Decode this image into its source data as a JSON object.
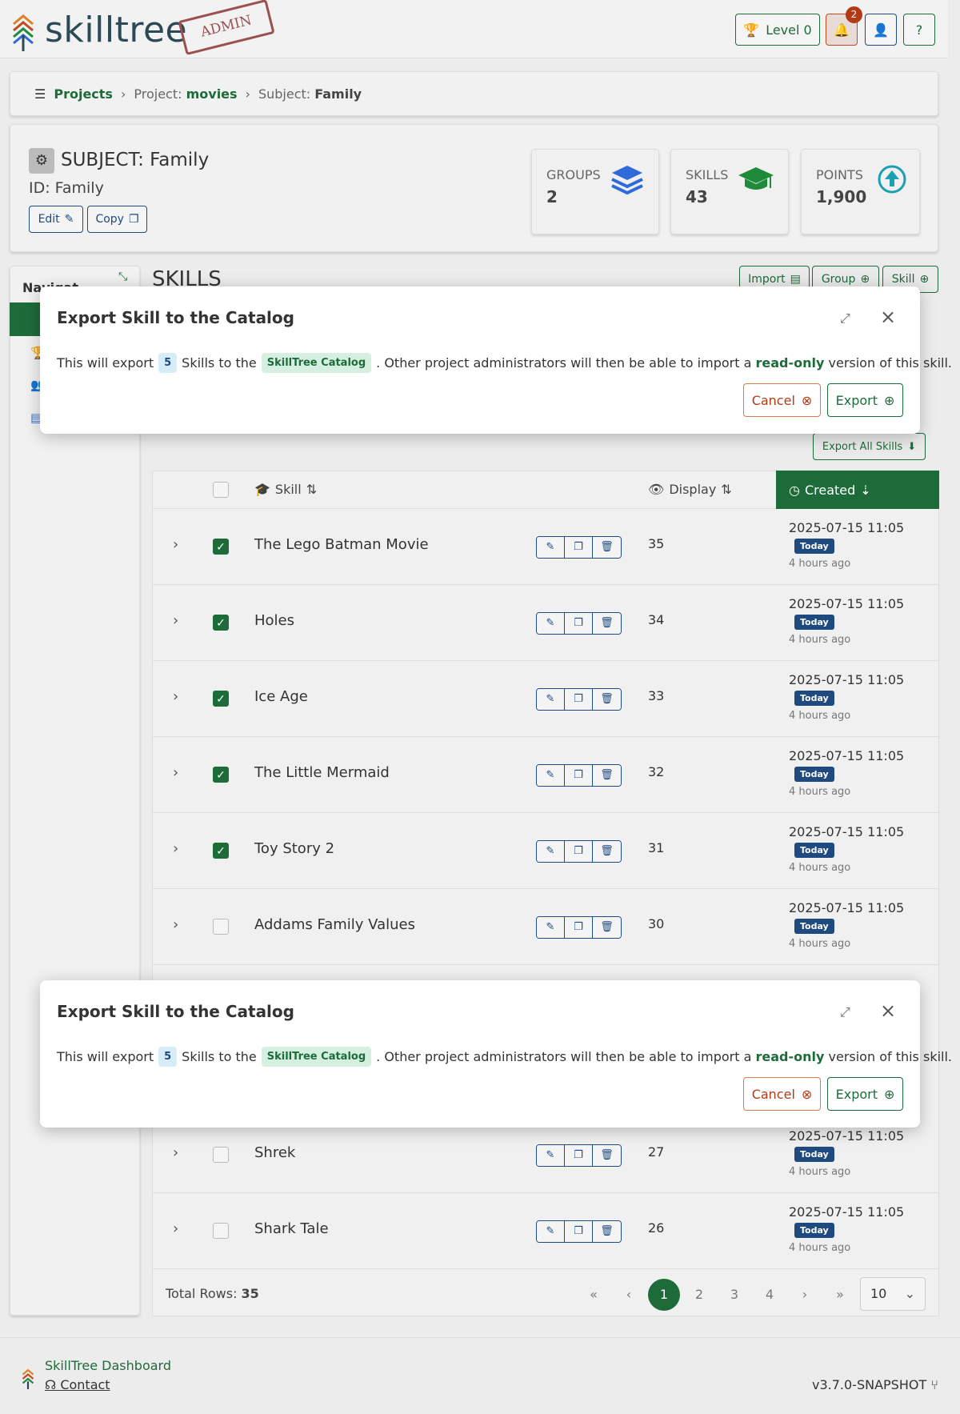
{
  "header": {
    "logo": "skilltree",
    "admin_stamp": "ADMIN",
    "level_label": "Level 0",
    "notification_count": "2"
  },
  "breadcrumb": {
    "projects": "Projects",
    "project_prefix": "Project:",
    "project_name": "movies",
    "subject_prefix": "Subject:",
    "subject_name": "Family"
  },
  "subject": {
    "title": "SUBJECT: Family",
    "id_label": "ID: Family",
    "edit_label": "Edit",
    "copy_label": "Copy"
  },
  "stats": [
    {
      "label": "GROUPS",
      "value": "2",
      "color": "#2e6bd9"
    },
    {
      "label": "SKILLS",
      "value": "43",
      "color": "#1e8a3a"
    },
    {
      "label": "POINTS",
      "value": "1,900",
      "color": "#1aa0b0"
    }
  ],
  "nav": {
    "title": "Navigat"
  },
  "skills": {
    "title": "SKILLS",
    "import_label": "Import",
    "group_label": "Group",
    "skill_label": "Skill",
    "export_all_label": "Export All Skills",
    "col_skill": "Skill",
    "col_display": "Display",
    "col_created": "Created",
    "rows": [
      {
        "name": "The Lego Batman Movie",
        "display": "35",
        "created": "2025-07-15 11:05",
        "badge": "Today",
        "ago": "4 hours ago",
        "checked": true
      },
      {
        "name": "Holes",
        "display": "34",
        "created": "2025-07-15 11:05",
        "badge": "Today",
        "ago": "4 hours ago",
        "checked": true
      },
      {
        "name": "Ice Age",
        "display": "33",
        "created": "2025-07-15 11:05",
        "badge": "Today",
        "ago": "4 hours ago",
        "checked": true
      },
      {
        "name": "The Little Mermaid",
        "display": "32",
        "created": "2025-07-15 11:05",
        "badge": "Today",
        "ago": "4 hours ago",
        "checked": true
      },
      {
        "name": "Toy Story 2",
        "display": "31",
        "created": "2025-07-15 11:05",
        "badge": "Today",
        "ago": "4 hours ago",
        "checked": true
      },
      {
        "name": "Addams Family Values",
        "display": "30",
        "created": "2025-07-15 11:05",
        "badge": "Today",
        "ago": "4 hours ago",
        "checked": false
      },
      {
        "name": "Shrek",
        "display": "27",
        "created": "2025-07-15 11:05",
        "badge": "Today",
        "ago": "4 hours ago",
        "checked": false
      },
      {
        "name": "Shark Tale",
        "display": "26",
        "created": "2025-07-15 11:05",
        "badge": "Today",
        "ago": "4 hours ago",
        "checked": false
      }
    ],
    "total_rows_label": "Total Rows:",
    "total_rows": "35",
    "pages": [
      "1",
      "2",
      "3",
      "4"
    ],
    "page_size": "10"
  },
  "modal": {
    "title": "Export Skill to the Catalog",
    "text1": "This will export",
    "count": "5",
    "text2": "Skills to the",
    "catalog": "SkillTree Catalog",
    "text3": ". Other project administrators will then be able to import a",
    "readonly": "read-only",
    "text4": "version of this skill.",
    "cancel_label": "Cancel",
    "export_label": "Export"
  },
  "footer": {
    "dashboard": "SkillTree Dashboard",
    "contact": "Contact",
    "version": "v3.7.0-SNAPSHOT"
  }
}
